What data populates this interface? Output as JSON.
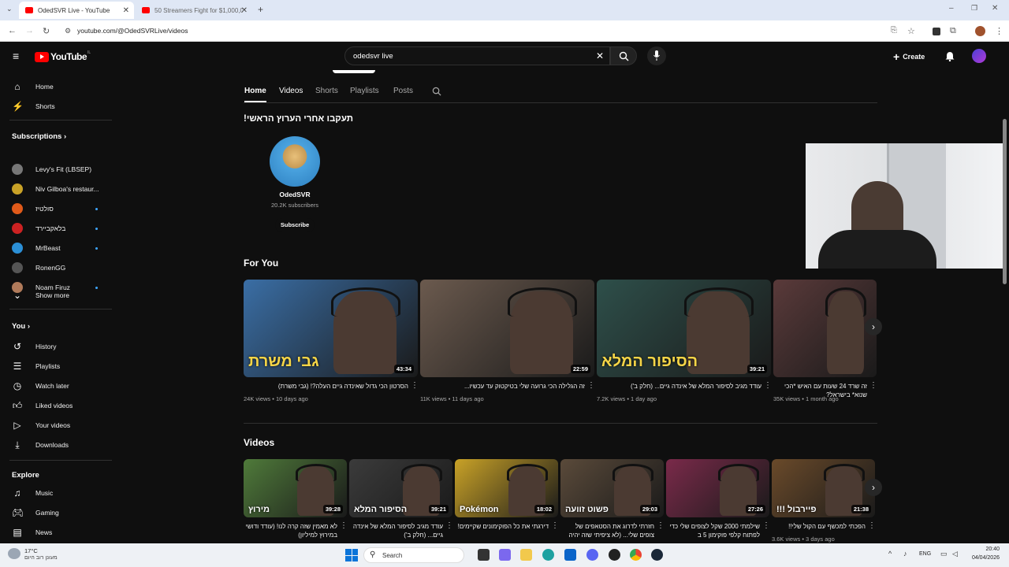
{
  "browser": {
    "tabs": [
      {
        "title": "OdedSVR Live - YouTube",
        "active": true
      },
      {
        "title": "50 Streamers Fight for $1,000,0",
        "active": false
      }
    ],
    "url": "youtube.com/@OdedSVRLive/videos"
  },
  "header": {
    "logo_text": "YouTube",
    "logo_sup": "IL",
    "search_value": "odedsvr live",
    "create_label": "Create"
  },
  "sidebar": {
    "main": [
      {
        "label": "Home",
        "icon": "home-icon"
      },
      {
        "label": "Shorts",
        "icon": "shorts-icon"
      }
    ],
    "subscriptions_title": "Subscriptions",
    "subscriptions": [
      {
        "label": "Levy's Fit (LBSEP)",
        "color": "#777777",
        "dot": false
      },
      {
        "label": "Niv Gilboa's restaur...",
        "color": "#c9a227",
        "dot": false
      },
      {
        "label": "סולטיז",
        "color": "#e05a1a",
        "dot": true
      },
      {
        "label": "בלאקביירד",
        "color": "#cc2222",
        "dot": true
      },
      {
        "label": "MrBeast",
        "color": "#2b8fd6",
        "dot": true
      },
      {
        "label": "RonenGG",
        "color": "#555555",
        "dot": false
      },
      {
        "label": "Noam Firuz",
        "color": "#b07a5a",
        "dot": true
      }
    ],
    "show_more": "Show more",
    "you_title": "You",
    "you_items": [
      {
        "label": "History",
        "icon": "history-icon"
      },
      {
        "label": "Playlists",
        "icon": "playlists-icon"
      },
      {
        "label": "Watch later",
        "icon": "watch-later-icon"
      },
      {
        "label": "Liked videos",
        "icon": "like-icon"
      },
      {
        "label": "Your videos",
        "icon": "your-videos-icon"
      },
      {
        "label": "Downloads",
        "icon": "download-icon"
      }
    ],
    "explore_title": "Explore",
    "explore_items": [
      {
        "label": "Music",
        "icon": "music-icon"
      },
      {
        "label": "Gaming",
        "icon": "gaming-icon"
      },
      {
        "label": "News",
        "icon": "news-icon"
      }
    ]
  },
  "channel": {
    "tabs": [
      "Home",
      "Videos",
      "Shorts",
      "Playlists",
      "Posts"
    ],
    "active_tab": "Home",
    "featured_heading": "!תעקבו אחרי הערוץ הראשי",
    "featured_name": "OdedSVR",
    "featured_subs": "20.2K subscribers",
    "subscribe_label": "Subscribe"
  },
  "for_you": {
    "title": "For You",
    "videos": [
      {
        "title": "הסרטון הכי גדול שאינדה גיים העלה?! (גבי משרת)",
        "meta": "24K views • 10 days ago",
        "duration": "43:34",
        "overlay": "גבי משרת",
        "bg": "#3a6ea5"
      },
      {
        "title": "זה הגלילה הכי גרועה שלי בטיקטוק עד עכשיו...",
        "meta": "11K views • 11 days ago",
        "duration": "22:59",
        "overlay": "",
        "bg": "#6b5a4e"
      },
      {
        "title": "עודד מגיב לסיפור המלא של אינדה גיים... (חלק ב')",
        "meta": "7.2K views • 1 day ago",
        "duration": "39:21",
        "overlay": "הסיפור המלא",
        "bg": "#2e4f4a"
      },
      {
        "title": "זה שרד 24 שעות עם האיש *הכי שנוא* בישראל?",
        "meta": "35K views • 1 month ago",
        "duration": "",
        "overlay": "",
        "bg": "#5a3a3a"
      }
    ]
  },
  "videos": {
    "title": "Videos",
    "items": [
      {
        "title": "לא מאמין שזה קרה לנו! (עודד ודושי במירוץ למיליון)",
        "meta": "",
        "duration": "39:28",
        "overlay": "מירוץ",
        "bg": "#4f7a3a"
      },
      {
        "title": "עודד מגיב לסיפור המלא של אינדה גיים... (חלק ב')",
        "meta": "",
        "duration": "39:21",
        "overlay": "הסיפור המלא",
        "bg": "#3b3b3b"
      },
      {
        "title": "דירגתי את כל הפוקימונים שקיימים!",
        "meta": "",
        "duration": "18:02",
        "overlay": "Pokémon",
        "bg": "#c9a227"
      },
      {
        "title": "חזרתי לדרוג את הסטאפים של צופים שלי... (לא ציפיתי שזה יהיה",
        "meta": "",
        "duration": "29:03",
        "overlay": "פשוט זוועה",
        "bg": "#5a4a3a"
      },
      {
        "title": "שילמתי 2000 שקל לצופים שלי כדי לפתוח קלפי פוקימון 5 ב",
        "meta": "",
        "duration": "27:26",
        "overlay": "",
        "bg": "#7a2a4a"
      },
      {
        "title": "הפכתי למכשף עם הקול שלי!!",
        "meta": "3.6K views • 3 days ago",
        "duration": "21:38",
        "overlay": "!!! פיירבול",
        "bg": "#6a4a2a"
      }
    ]
  },
  "taskbar": {
    "weather_temp": "17°C",
    "weather_desc": "מעונן רוב היום",
    "search_label": "Search",
    "lang": "ENG",
    "time": "20:40",
    "date": "04/04/2026"
  }
}
